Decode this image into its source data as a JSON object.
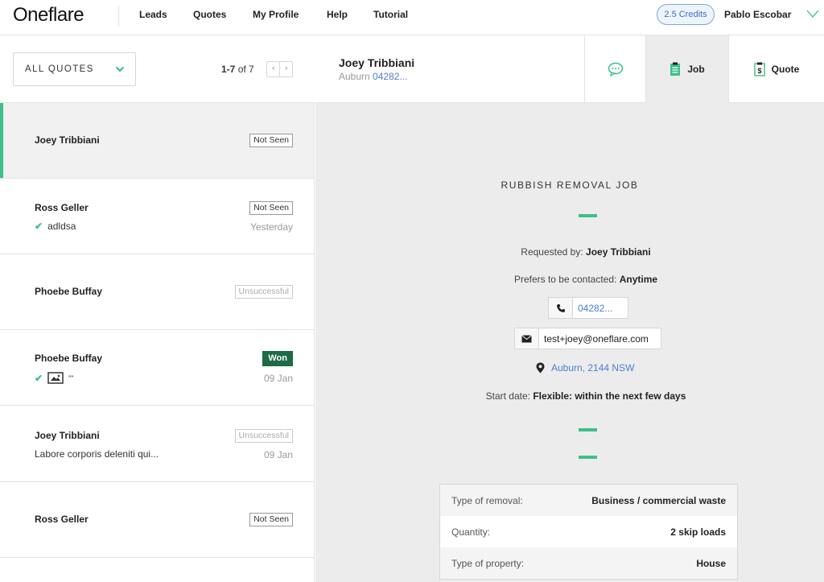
{
  "nav": {
    "logo": "Oneflare",
    "links": [
      "Leads",
      "Quotes",
      "My Profile",
      "Help",
      "Tutorial"
    ],
    "credits": "2.5 Credits",
    "user_name": "Pablo Escobar"
  },
  "left_panel": {
    "filter_label": "ALL QUOTES",
    "pager_range": "1-7",
    "pager_of": "of 7",
    "leads": [
      {
        "name": "Joey Tribbiani",
        "badge": "Not Seen",
        "sub": "",
        "date": ""
      },
      {
        "name": "Ross Geller",
        "badge": "Not Seen",
        "sub": "adldsa",
        "date": "Yesterday"
      },
      {
        "name": "Phoebe Buffay",
        "badge": "Unsuccessful",
        "sub": "",
        "date": ""
      },
      {
        "name": "Phoebe Buffay",
        "badge": "Won",
        "sub": "\"\"",
        "date": "09 Jan"
      },
      {
        "name": "Joey Tribbiani",
        "badge": "Unsuccessful",
        "sub": "Labore corporis deleniti qui...",
        "date": "09 Jan"
      },
      {
        "name": "Ross Geller",
        "badge": "Not Seen",
        "sub": "",
        "date": ""
      }
    ]
  },
  "detail_header": {
    "name": "Joey Tribbiani",
    "suburb": "Auburn",
    "phone": "04282...",
    "tabs": {
      "job": "Job",
      "quote": "Quote"
    }
  },
  "job": {
    "title": "RUBBISH REMOVAL JOB",
    "requested_by_label": "Requested by:",
    "requested_by": "Joey Tribbiani",
    "contact_pref_label": "Prefers to be contacted:",
    "contact_pref": "Anytime",
    "phone": "04282...",
    "email": "test+joey@oneflare.com",
    "location": "Auburn, 2144 NSW",
    "start_label": "Start date:",
    "start_value": "Flexible: within the next few days",
    "details": [
      {
        "label": "Type of removal:",
        "value": "Business / commercial waste"
      },
      {
        "label": "Quantity:",
        "value": "2 skip loads"
      },
      {
        "label": "Type of property:",
        "value": "House"
      }
    ]
  },
  "colors": {
    "accent": "#3fbf8a",
    "link": "#4a7fd4",
    "won": "#1e6b45"
  }
}
